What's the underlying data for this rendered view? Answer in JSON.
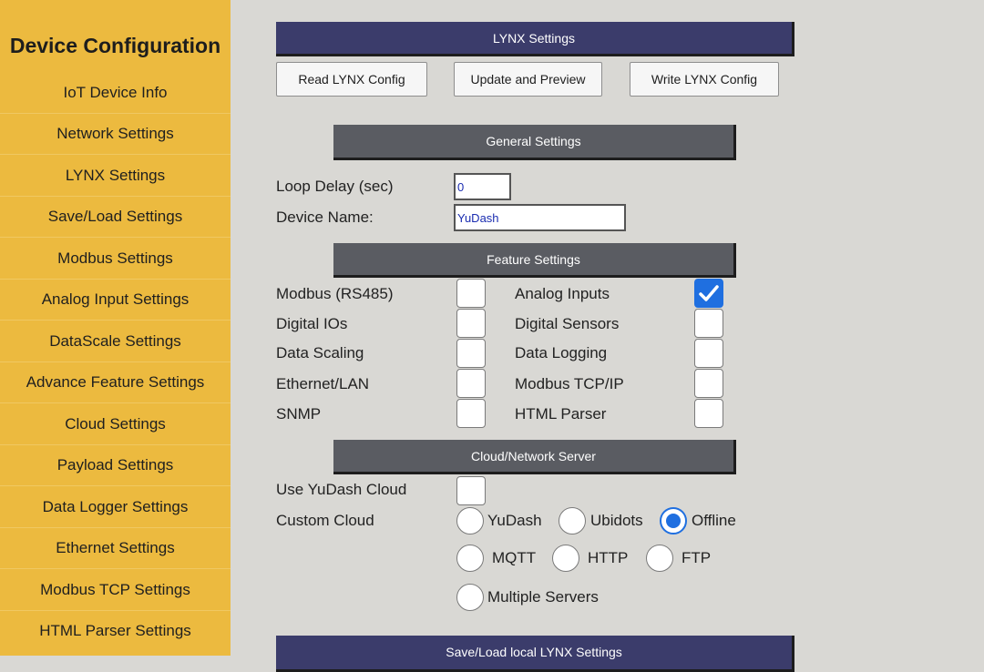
{
  "sidebar": {
    "title": "Device Configuration",
    "items": [
      "IoT Device Info",
      "Network Settings",
      "LYNX Settings",
      "Save/Load Settings",
      "Modbus Settings",
      "Analog Input Settings",
      "DataScale Settings",
      "Advance Feature Settings",
      "Cloud Settings",
      "Payload Settings",
      "Data Logger Settings",
      "Ethernet Settings",
      "Modbus TCP Settings",
      "HTML Parser Settings"
    ]
  },
  "lynx": {
    "header": "LYNX Settings",
    "read_label": "Read LYNX Config",
    "update_label": "Update and Preview",
    "write_label": "Write LYNX Config"
  },
  "general": {
    "header": "General Settings",
    "loop_delay_label": "Loop Delay (sec)",
    "loop_delay_value": "0",
    "device_name_label": "Device Name:",
    "device_name_value": "YuDash"
  },
  "features": {
    "header": "Feature Settings",
    "left": [
      {
        "label": "Modbus (RS485)",
        "checked": false
      },
      {
        "label": "Digital IOs",
        "checked": false
      },
      {
        "label": "Data Scaling",
        "checked": false
      },
      {
        "label": "Ethernet/LAN",
        "checked": false
      },
      {
        "label": "SNMP",
        "checked": false
      }
    ],
    "right": [
      {
        "label": "Analog Inputs",
        "checked": true
      },
      {
        "label": "Digital Sensors",
        "checked": false
      },
      {
        "label": "Data Logging",
        "checked": false
      },
      {
        "label": "Modbus TCP/IP",
        "checked": false
      },
      {
        "label": "HTML Parser",
        "checked": false
      }
    ]
  },
  "cloud": {
    "header": "Cloud/Network Server",
    "use_yudash_label": "Use YuDash Cloud",
    "use_yudash_checked": false,
    "custom_label": "Custom Cloud",
    "options": [
      "YuDash",
      "Ubidots",
      "Offline",
      "MQTT",
      "HTTP",
      "FTP",
      "Multiple Servers"
    ],
    "selected": "Offline"
  },
  "saveload": {
    "header": "Save/Load local LYNX Settings"
  },
  "colors": {
    "sidebar_bg": "#ecba3f",
    "navy_bar": "#3b3c6b",
    "gray_bar": "#5a5c62",
    "accent": "#1f6fe0"
  }
}
